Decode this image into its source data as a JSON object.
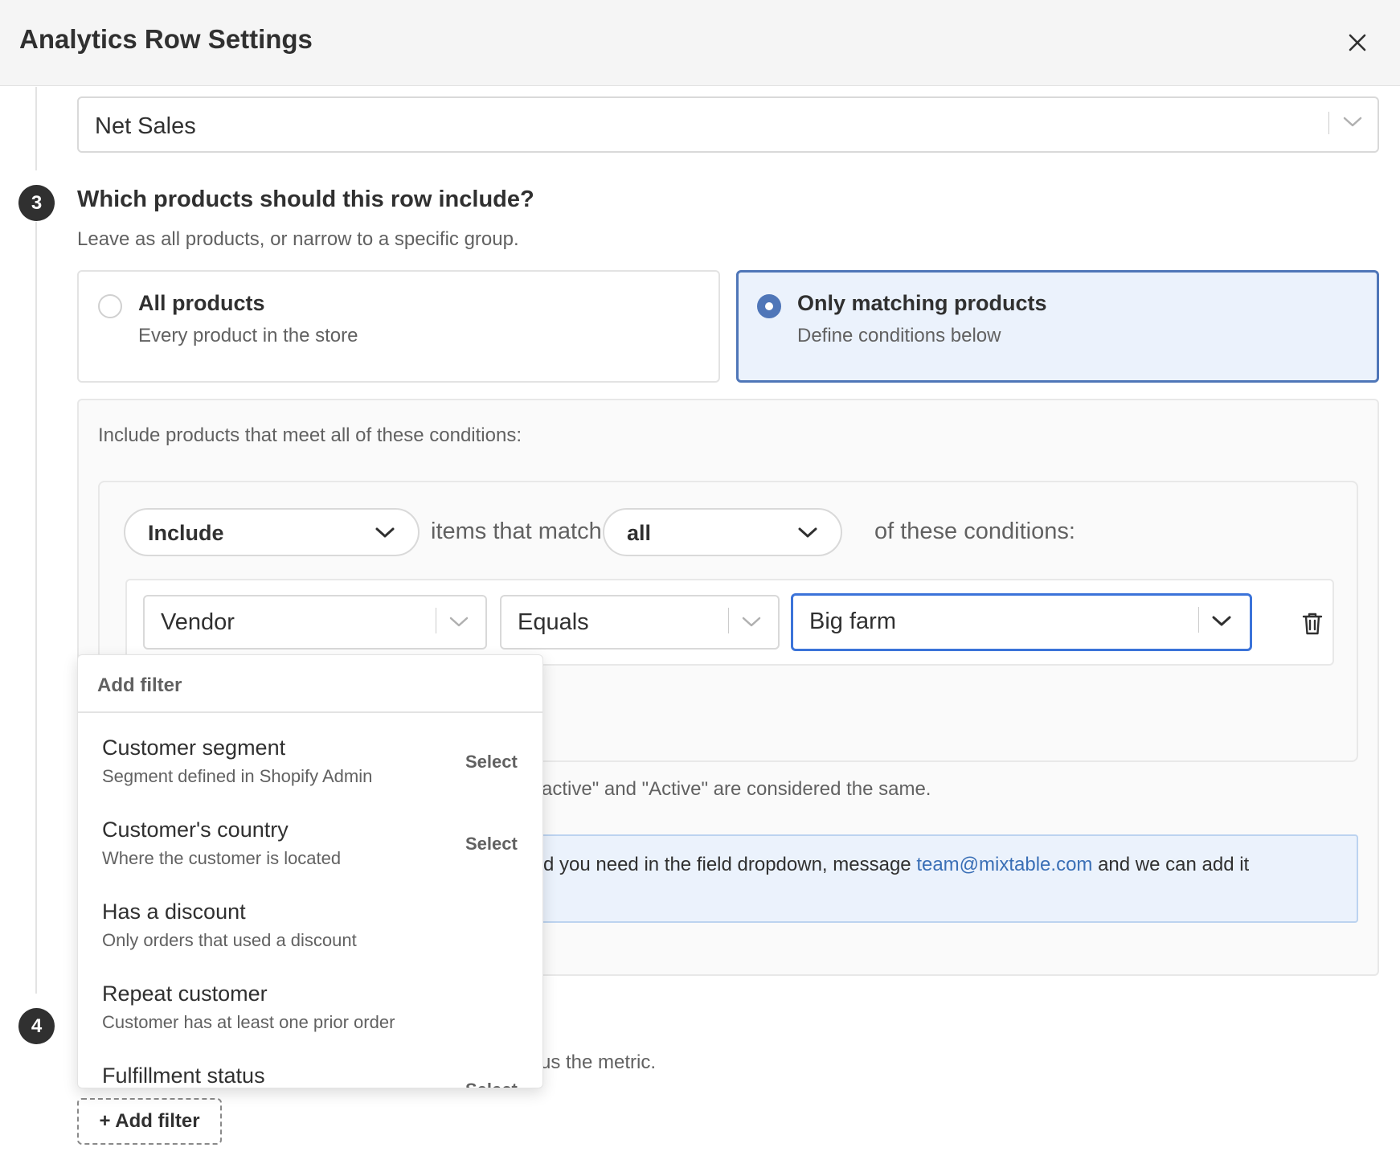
{
  "header": {
    "title": "Analytics Row Settings"
  },
  "metric": {
    "value": "Net Sales"
  },
  "step3": {
    "number": "3",
    "title": "Which products should this row include?",
    "subtitle": "Leave as all products, or narrow to a specific group."
  },
  "options": {
    "all": {
      "label": "All products",
      "desc": "Every product in the store",
      "selected": false
    },
    "matching": {
      "label": "Only matching products",
      "desc": "Define conditions below",
      "selected": true
    }
  },
  "conditions": {
    "intro": "Include products that meet all of these conditions:",
    "mode": "Include",
    "text_match": "items that match",
    "quantifier": "all",
    "text_of": "of these conditions:",
    "row": {
      "field": "Vendor",
      "operator": "Equals",
      "value": "Big farm"
    },
    "note": "active\" and \"Active\" are considered the same.",
    "info_before": "d you need in the field dropdown, message ",
    "info_email": "team@mixtable.com",
    "info_after": " and we can add it"
  },
  "step4": {
    "number": "4",
    "subtitle": "us the metric."
  },
  "add_filter_label": "+ Add filter",
  "dropdown": {
    "header": "Add filter",
    "items": [
      {
        "title": "Customer segment",
        "desc": "Segment defined in Shopify Admin",
        "action": "Select"
      },
      {
        "title": "Customer's country",
        "desc": "Where the customer is located",
        "action": "Select"
      },
      {
        "title": "Has a discount",
        "desc": "Only orders that used a discount",
        "action": ""
      },
      {
        "title": "Repeat customer",
        "desc": "Customer has at least one prior order",
        "action": ""
      },
      {
        "title": "Fulfillment status",
        "desc": "",
        "action": "Select"
      }
    ]
  },
  "colors": {
    "accent": "#4f76b8",
    "focus": "#3b73d9",
    "text": "#303030",
    "muted": "#616161"
  }
}
